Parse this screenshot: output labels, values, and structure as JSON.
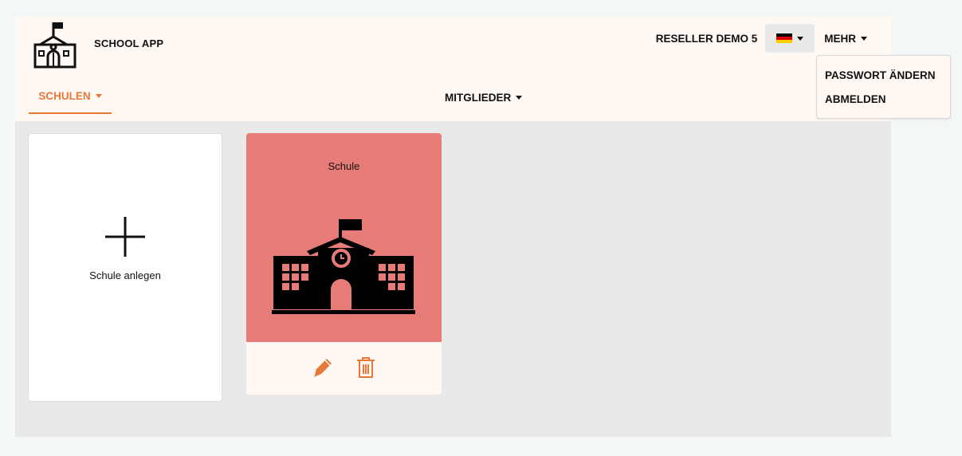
{
  "app": {
    "title": "SCHOOL APP",
    "logo_icon": "school-building-icon"
  },
  "header": {
    "reseller": "RESELLER DEMO 5",
    "language": {
      "flag": "de-flag",
      "colors": [
        "#000000",
        "#dd0000",
        "#ffce00"
      ]
    },
    "more_label": "MEHR"
  },
  "nav": {
    "tabs": [
      {
        "label": "SCHULEN",
        "active": true
      },
      {
        "label": "MITGLIEDER",
        "active": false
      }
    ]
  },
  "more_menu": {
    "items": [
      {
        "label": "PASSWORT ÄNDERN"
      },
      {
        "label": "ABMELDEN"
      }
    ]
  },
  "cards": {
    "new": {
      "label": "Schule anlegen",
      "icon": "plus-icon"
    },
    "schools": [
      {
        "name": "Schule",
        "icon": "school-building-icon",
        "color": "#e77b78",
        "actions": [
          {
            "icon": "pencil-icon"
          },
          {
            "icon": "trash-icon"
          }
        ]
      }
    ]
  },
  "theme": {
    "accent": "#e8773a",
    "header_bg": "#fff8f3",
    "content_bg": "#e9e9e9"
  }
}
